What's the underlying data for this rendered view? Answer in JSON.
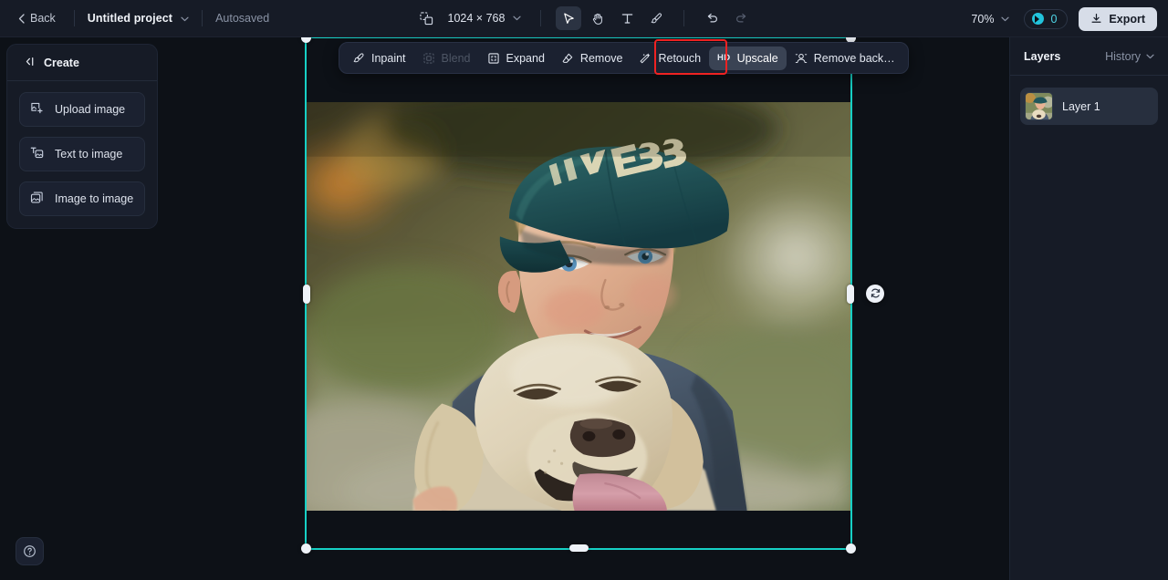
{
  "topbar": {
    "back_label": "Back",
    "project_name": "Untitled project",
    "autosave_label": "Autosaved",
    "canvas_size": "1024 × 768",
    "zoom_level": "70%",
    "credits_count": "0",
    "export_label": "Export",
    "tools": [
      {
        "name": "select-tool",
        "active": true
      },
      {
        "name": "hand-tool",
        "active": false
      },
      {
        "name": "text-tool",
        "active": false
      },
      {
        "name": "brush-tool",
        "active": false
      },
      {
        "name": "undo-tool",
        "active": false
      },
      {
        "name": "redo-tool",
        "active": false
      }
    ]
  },
  "sidebar": {
    "title": "Create",
    "collapse_icon": "collapse-left-icon",
    "items": [
      {
        "label": "Upload image",
        "icon": "upload-image-icon"
      },
      {
        "label": "Text to image",
        "icon": "text-to-image-icon"
      },
      {
        "label": "Image to image",
        "icon": "image-to-image-icon"
      }
    ],
    "help_icon": "help-circle-icon"
  },
  "floating_toolbar": {
    "items": [
      {
        "label": "Inpaint",
        "icon": "inpaint-brush-icon",
        "state": "normal"
      },
      {
        "label": "Blend",
        "icon": "blend-icon",
        "state": "disabled"
      },
      {
        "label": "Expand",
        "icon": "expand-icon",
        "state": "normal"
      },
      {
        "label": "Remove",
        "icon": "eraser-icon",
        "state": "normal"
      },
      {
        "label": "Retouch",
        "icon": "retouch-wand-icon",
        "state": "normal"
      },
      {
        "label": "Upscale",
        "icon": "hd-badge",
        "badge": "HD",
        "state": "active"
      },
      {
        "label": "Remove back…",
        "icon": "remove-background-icon",
        "state": "normal"
      }
    ],
    "highlight_color": "#ef2222",
    "highlighted_item": "Upscale"
  },
  "right_panel": {
    "tab_layers": "Layers",
    "tab_history": "History",
    "layers": [
      {
        "name": "Layer 1",
        "selected": true
      }
    ]
  },
  "canvas": {
    "selection_color": "#16d0c5",
    "rotate_icon": "rotate-icon",
    "image_alt": "Boy in teal baseball cap hugging a golden retriever outdoors"
  }
}
